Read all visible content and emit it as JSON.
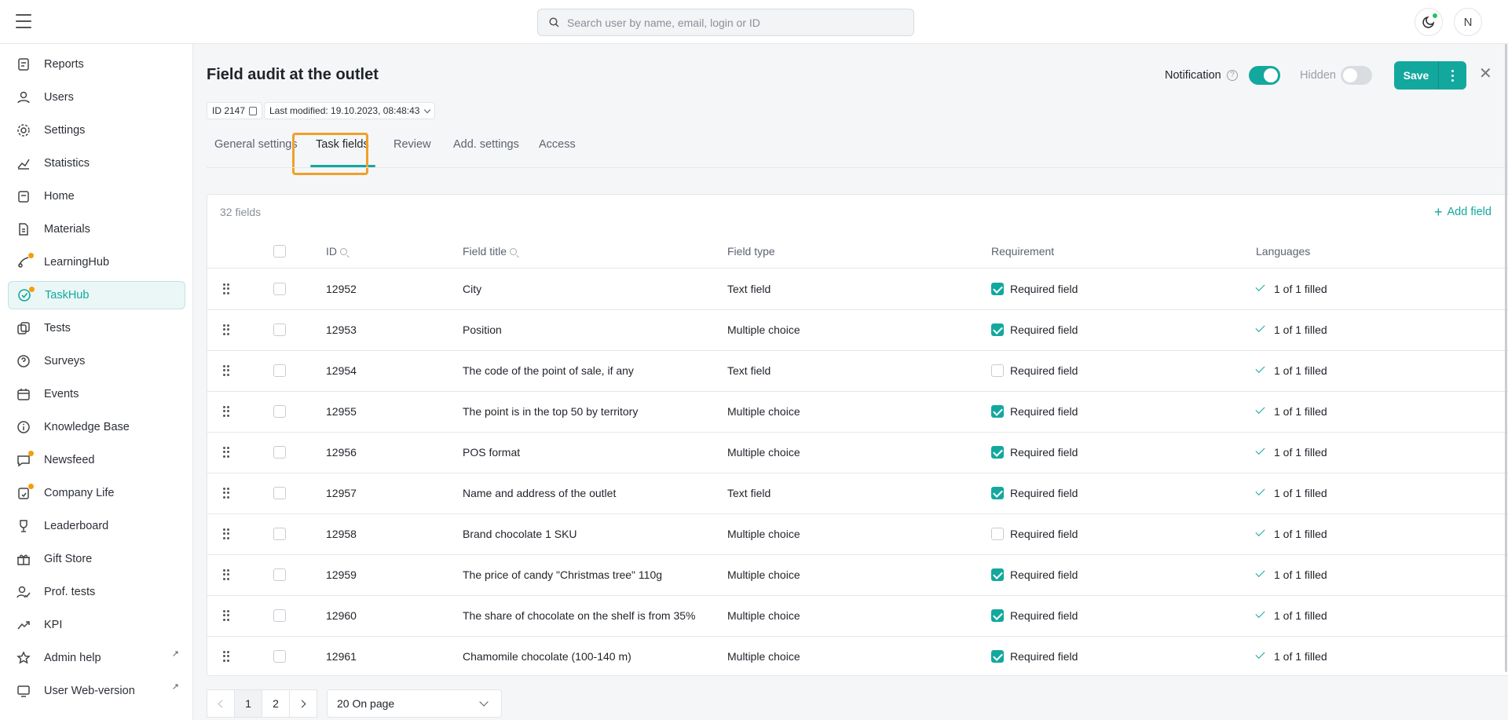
{
  "search": {
    "placeholder": "Search user by name, email, login or ID"
  },
  "user": {
    "initial": "N"
  },
  "sidebar": {
    "items": [
      {
        "label": "Reports",
        "icon": "report-icon"
      },
      {
        "label": "Users",
        "icon": "user-icon"
      },
      {
        "label": "Settings",
        "icon": "gear-icon"
      },
      {
        "label": "Statistics",
        "icon": "chart-icon"
      },
      {
        "label": "Home",
        "icon": "home-icon"
      },
      {
        "label": "Materials",
        "icon": "document-icon"
      },
      {
        "label": "LearningHub",
        "icon": "learning-icon",
        "badge": true
      },
      {
        "label": "TaskHub",
        "icon": "task-icon",
        "badge": true,
        "active": true
      },
      {
        "label": "Tests",
        "icon": "tests-icon"
      },
      {
        "label": "Surveys",
        "icon": "survey-icon"
      },
      {
        "label": "Events",
        "icon": "calendar-icon"
      },
      {
        "label": "Knowledge Base",
        "icon": "info-icon"
      },
      {
        "label": "Newsfeed",
        "icon": "chat-icon",
        "badge": true
      },
      {
        "label": "Company Life",
        "icon": "company-icon",
        "badge": true
      },
      {
        "label": "Leaderboard",
        "icon": "trophy-icon"
      },
      {
        "label": "Gift Store",
        "icon": "gift-icon"
      },
      {
        "label": "Prof. tests",
        "icon": "prof-test-icon"
      },
      {
        "label": "KPI",
        "icon": "trend-icon"
      },
      {
        "label": "Admin help",
        "icon": "star-icon",
        "external": true
      },
      {
        "label": "User Web-version",
        "icon": "monitor-icon",
        "external": true
      }
    ],
    "external_glyph": "↗"
  },
  "header": {
    "title": "Field audit at the outlet",
    "notification_label": "Notification",
    "notification_on": true,
    "hidden_label": "Hidden",
    "hidden_on": false,
    "save_label": "Save",
    "help_glyph": "?",
    "close_glyph": "✕"
  },
  "meta": {
    "id_label": "ID 2147",
    "last_modified": "Last modified: 19.10.2023, 08:48:43"
  },
  "tabs": [
    {
      "label": "General settings"
    },
    {
      "label": "Task fields",
      "active": true
    },
    {
      "label": "Review"
    },
    {
      "label": "Add. settings"
    },
    {
      "label": "Access"
    }
  ],
  "table": {
    "count_label": "32 fields",
    "add_field_label": "Add field",
    "add_plus": "+",
    "columns": {
      "id": "ID",
      "title": "Field title",
      "type": "Field type",
      "requirement": "Requirement",
      "languages": "Languages"
    },
    "requirement_label": "Required field",
    "rows": [
      {
        "id": "12952",
        "title": "City",
        "type": "Text field",
        "required": true,
        "languages": "1 of 1 filled"
      },
      {
        "id": "12953",
        "title": "Position",
        "type": "Multiple choice",
        "required": true,
        "languages": "1 of 1 filled"
      },
      {
        "id": "12954",
        "title": "The code of the point of sale, if any",
        "type": "Text field",
        "required": false,
        "languages": "1 of 1 filled"
      },
      {
        "id": "12955",
        "title": "The point is in the top 50 by territory",
        "type": "Multiple choice",
        "required": true,
        "languages": "1 of 1 filled"
      },
      {
        "id": "12956",
        "title": "POS format",
        "type": "Multiple choice",
        "required": true,
        "languages": "1 of 1 filled"
      },
      {
        "id": "12957",
        "title": "Name and address of the outlet",
        "type": "Text field",
        "required": true,
        "languages": "1 of 1 filled"
      },
      {
        "id": "12958",
        "title": "Brand chocolate 1 SKU",
        "type": "Multiple choice",
        "required": false,
        "languages": "1 of 1 filled"
      },
      {
        "id": "12959",
        "title": "The price of candy \"Christmas tree\" 110g",
        "type": "Multiple choice",
        "required": true,
        "languages": "1 of 1 filled"
      },
      {
        "id": "12960",
        "title": "The share of chocolate on the shelf is from 35%",
        "type": "Multiple choice",
        "required": true,
        "languages": "1 of 1 filled"
      },
      {
        "id": "12961",
        "title": "Chamomile chocolate (100-140 m)",
        "type": "Multiple choice",
        "required": true,
        "languages": "1 of 1 filled"
      }
    ]
  },
  "pagination": {
    "pages": [
      "1",
      "2"
    ],
    "current": "1",
    "per_page": "20 On page"
  },
  "colors": {
    "accent": "#13a89e",
    "highlight": "#f0a028",
    "badge": "#f59e0b"
  }
}
